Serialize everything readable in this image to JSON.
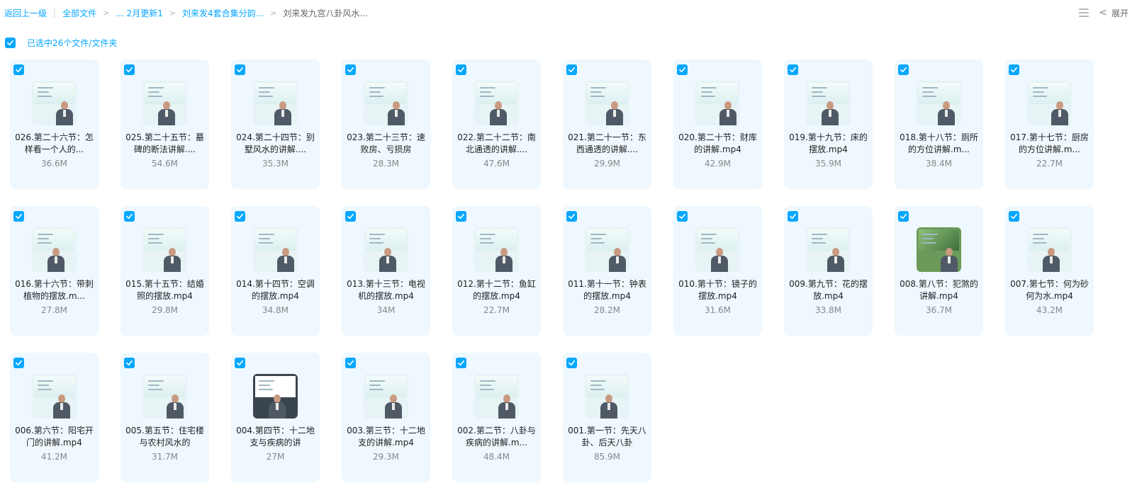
{
  "breadcrumb": {
    "back": "返回上一级",
    "items": [
      "全部文件",
      "... 2月更新1",
      "刘来发4套合集分韵...",
      "刘来发九宫八卦风水..."
    ],
    "sep": ">",
    "bar": "|"
  },
  "toolbar": {
    "expand_label": "展开",
    "chevron": "<",
    "list_icon": "list-view-icon"
  },
  "selection": {
    "label": "已选中26个文件/文件夹",
    "checked": true
  },
  "colors": {
    "accent": "#06a7ff",
    "card_bg": "#eef8fe"
  },
  "files": [
    {
      "name": "026.第二十六节：怎样看一个人的...",
      "size": "36.6M",
      "thumb": "light"
    },
    {
      "name": "025.第二十五节：墓碑的断法讲解....",
      "size": "54.6M",
      "thumb": "light"
    },
    {
      "name": "024.第二十四节：别墅风水的讲解....",
      "size": "35.3M",
      "thumb": "light"
    },
    {
      "name": "023.第二十三节：速败房、亏损房",
      "size": "28.3M",
      "thumb": "light"
    },
    {
      "name": "022.第二十二节：南北通透的讲解....",
      "size": "47.6M",
      "thumb": "light"
    },
    {
      "name": "021.第二十一节：东西通透的讲解....",
      "size": "29.9M",
      "thumb": "light"
    },
    {
      "name": "020.第二十节：财库的讲解.mp4",
      "size": "42.9M",
      "thumb": "light"
    },
    {
      "name": "019.第十九节：床的摆放.mp4",
      "size": "35.9M",
      "thumb": "light"
    },
    {
      "name": "018.第十八节：厕所的方位讲解.m...",
      "size": "38.4M",
      "thumb": "light"
    },
    {
      "name": "017.第十七节：厨房的方位讲解.m...",
      "size": "22.7M",
      "thumb": "light"
    },
    {
      "name": "016.第十六节：带刺植物的摆放.m...",
      "size": "27.8M",
      "thumb": "light"
    },
    {
      "name": "015.第十五节：结婚照的摆放.mp4",
      "size": "29.8M",
      "thumb": "light"
    },
    {
      "name": "014.第十四节：空调的摆放.mp4",
      "size": "34.8M",
      "thumb": "light"
    },
    {
      "name": "013.第十三节：电视机的摆放.mp4",
      "size": "34M",
      "thumb": "light"
    },
    {
      "name": "012.第十二节：鱼缸的摆放.mp4",
      "size": "22.7M",
      "thumb": "light"
    },
    {
      "name": "011.第十一节：钟表的摆放.mp4",
      "size": "28.2M",
      "thumb": "light"
    },
    {
      "name": "010.第十节：镜子的摆放.mp4",
      "size": "31.6M",
      "thumb": "light"
    },
    {
      "name": "009.第九节：花的摆放.mp4",
      "size": "33.8M",
      "thumb": "light"
    },
    {
      "name": "008.第八节：犯煞的讲解.mp4",
      "size": "36.7M",
      "thumb": "green"
    },
    {
      "name": "007.第七节：何为砂何为水.mp4",
      "size": "43.2M",
      "thumb": "light"
    },
    {
      "name": "006.第六节：阳宅开门的讲解.mp4",
      "size": "41.2M",
      "thumb": "light"
    },
    {
      "name": "005.第五节：住宅楼与农村风水的",
      "size": "31.7M",
      "thumb": "light"
    },
    {
      "name": "004.第四节：十二地支与疾病的讲",
      "size": "27M",
      "thumb": "dark"
    },
    {
      "name": "003.第三节：十二地支的讲解.mp4",
      "size": "29.3M",
      "thumb": "light"
    },
    {
      "name": "002.第二节：八卦与疾病的讲解.m...",
      "size": "48.4M",
      "thumb": "light"
    },
    {
      "name": "001.第一节：先天八卦、后天八卦",
      "size": "85.9M",
      "thumb": "light"
    }
  ]
}
